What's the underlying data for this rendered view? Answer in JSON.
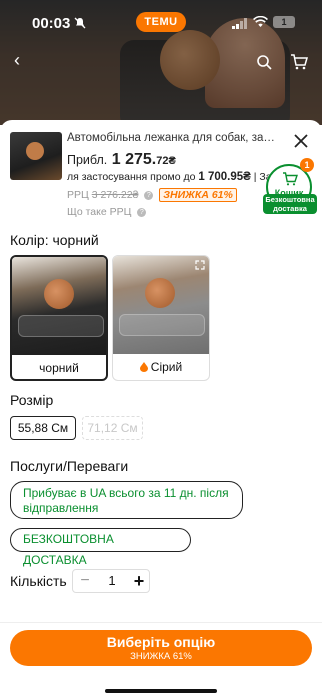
{
  "status_bar": {
    "time": "00:03",
    "app_badge": "TEMU",
    "battery": "1"
  },
  "product": {
    "title": "Автомобільна лежанка для собак, задн...",
    "price_prefix": "Прибл.",
    "price_main": "1 275.",
    "price_cents": "72₴",
    "promo_text": "ля застосування промо до",
    "promo_price": "1 700.95₴",
    "promo_suffix": "| Зак",
    "rrp_label": "РРЦ",
    "rrp_value": "3 276.22₴",
    "discount_badge": "ЗНИЖКА 61%",
    "rrp_what": "Що таке РРЦ"
  },
  "cart": {
    "label": "Кошик",
    "count": "1",
    "free_shipping": "Безкоштовна доставка"
  },
  "color": {
    "label": "Колір: чорний",
    "options": [
      {
        "label": "чорний",
        "selected": true
      },
      {
        "label": "Сірий",
        "selected": false
      }
    ]
  },
  "size": {
    "label": "Розмір",
    "options": [
      {
        "label": "55,88 См",
        "selected": true
      },
      {
        "label": "71,12 См",
        "selected": false
      }
    ]
  },
  "services": {
    "label": "Послуги/Переваги",
    "delivery": "Прибуває в UA всього за 11 дн. після відправлення",
    "free": "БЕЗКОШТОВНА ДОСТАВКА"
  },
  "quantity": {
    "label": "Кількість",
    "value": "1",
    "minus": "−",
    "plus": "+"
  },
  "cta": {
    "main": "Виберіть опцію",
    "sub": "ЗНИЖКА 61%"
  },
  "colors": {
    "accent": "#fb7701",
    "green": "#0a8f2f"
  }
}
